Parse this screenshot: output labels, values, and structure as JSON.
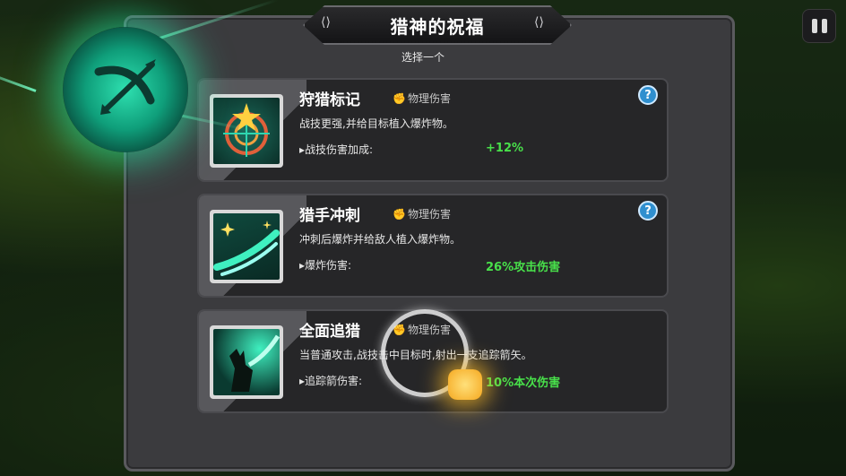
{
  "dialog": {
    "title": "猎神的祝福",
    "subtitle": "选择一个"
  },
  "hud": {
    "pause_icon": "pause-icon"
  },
  "emblem": {
    "icon": "bow-arrow-icon",
    "color": "#22d6a4"
  },
  "cards": [
    {
      "name": "狩猎标记",
      "damage_type": "物理伤害",
      "description": "战技更强,并给目标植入爆炸物。",
      "stat_label": "战技伤害加成:",
      "stat_value": "+12%",
      "has_help": true,
      "help_label": "?",
      "icon": "target-crosshair-icon"
    },
    {
      "name": "猎手冲刺",
      "damage_type": "物理伤害",
      "description": "冲刺后爆炸并给敌人植入爆炸物。",
      "stat_label": "爆炸伤害:",
      "stat_value": "26%攻击伤害",
      "has_help": true,
      "help_label": "?",
      "icon": "dash-slash-icon"
    },
    {
      "name": "全面追猎",
      "damage_type": "物理伤害",
      "description": "当普通攻击,战技击中目标时,射出一支追踪箭矢。",
      "stat_label": "追踪箭伤害:",
      "stat_value": "10%本次伤害",
      "has_help": false,
      "icon": "hunter-silhouette-icon"
    }
  ],
  "colors": {
    "accent_green": "#48e04a",
    "help_blue": "#2f8fcf"
  }
}
